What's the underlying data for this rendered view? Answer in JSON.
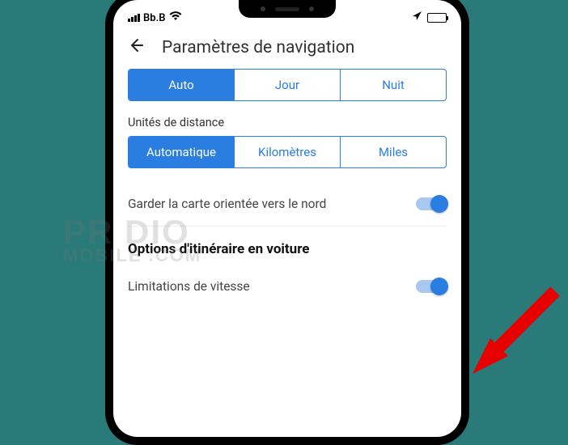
{
  "status": {
    "carrier": "Bb.B"
  },
  "header": {
    "title": "Paramètres de navigation"
  },
  "theme_tabs": {
    "auto": "Auto",
    "jour": "Jour",
    "nuit": "Nuit"
  },
  "distance": {
    "label": "Unités de distance",
    "auto": "Automatique",
    "km": "Kilomètres",
    "miles": "Miles"
  },
  "map_north": "Garder la carte orientée vers le nord",
  "route_section": "Options d'itinéraire en voiture",
  "speed_limit": "Limitations de vitesse",
  "watermark": {
    "line1": "PR DIO",
    "line2": "MOBILE .COM"
  }
}
